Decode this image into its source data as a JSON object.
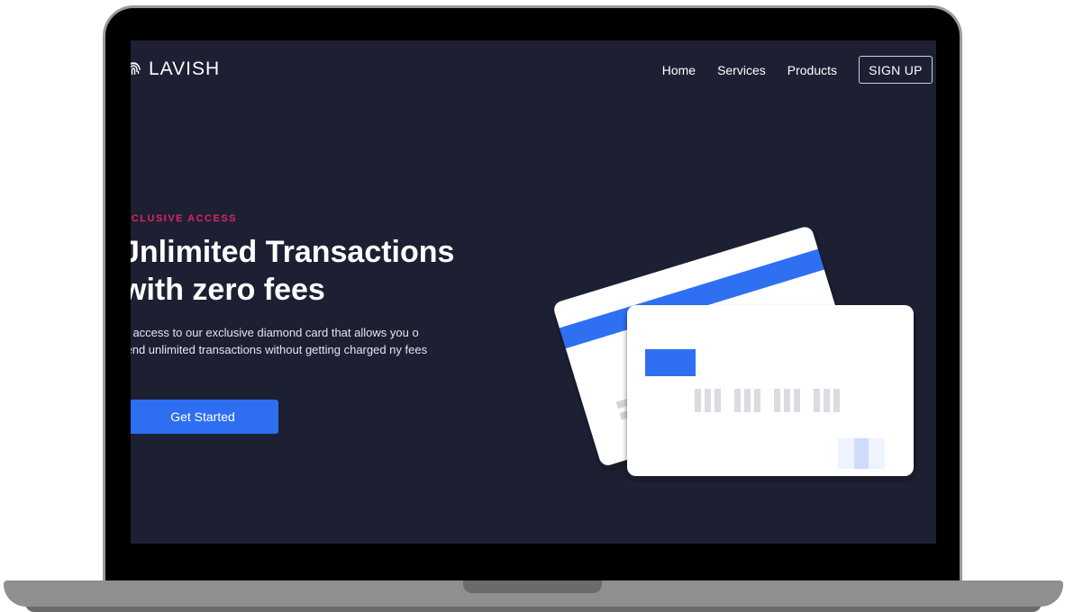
{
  "brand": {
    "name": "LAVISH"
  },
  "nav": {
    "links": [
      "Home",
      "Services",
      "Products"
    ],
    "signup_label": "SIGN UP"
  },
  "hero": {
    "eyebrow": "XCLUSIVE ACCESS",
    "headline_line1": "Jnlimited Transactions",
    "headline_line2": "with zero fees",
    "description": "et access to our exclusive diamond card that allows you o send unlimited transactions without getting charged ny fees",
    "cta_label": "Get Started"
  },
  "colors": {
    "screen_bg": "#1d2033",
    "accent_blue": "#2e6ff1",
    "eyebrow_pink": "#e0245e",
    "card_white": "#ffffff"
  },
  "icons": {
    "logo": "fingerprint-icon"
  }
}
